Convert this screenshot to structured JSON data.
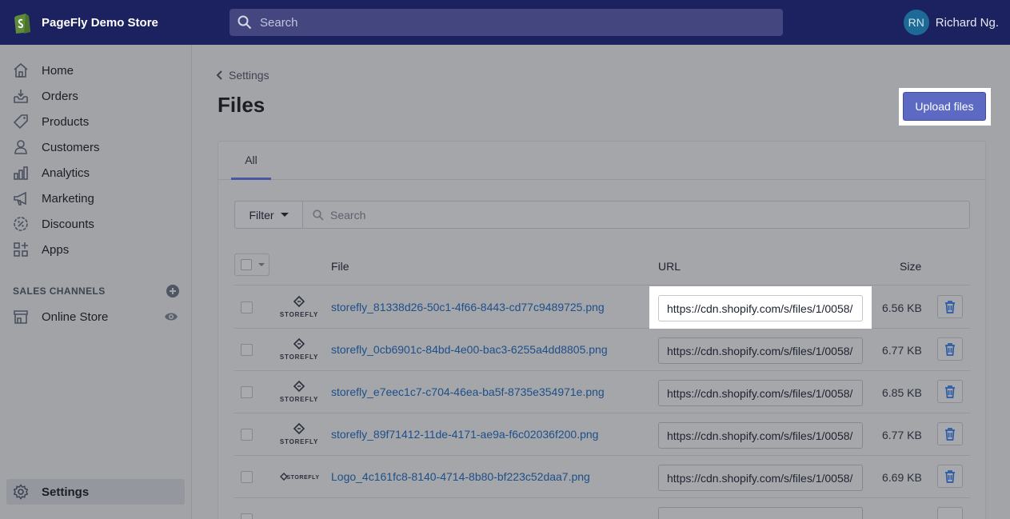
{
  "topbar": {
    "store_name": "PageFly Demo Store",
    "search_placeholder": "Search",
    "user_initials": "RN",
    "user_name": "Richard Ng."
  },
  "sidebar": {
    "items": [
      {
        "label": "Home",
        "icon": "home-icon"
      },
      {
        "label": "Orders",
        "icon": "orders-icon"
      },
      {
        "label": "Products",
        "icon": "tag-icon"
      },
      {
        "label": "Customers",
        "icon": "person-icon"
      },
      {
        "label": "Analytics",
        "icon": "bar-chart-icon"
      },
      {
        "label": "Marketing",
        "icon": "megaphone-icon"
      },
      {
        "label": "Discounts",
        "icon": "discount-icon"
      },
      {
        "label": "Apps",
        "icon": "apps-icon"
      }
    ],
    "sales_channels_title": "SALES CHANNELS",
    "online_store_label": "Online Store",
    "settings_label": "Settings"
  },
  "main": {
    "breadcrumb": "Settings",
    "title": "Files",
    "upload_label": "Upload files",
    "tab_all": "All",
    "filter_label": "Filter",
    "search_placeholder": "Search",
    "col_file": "File",
    "col_url": "URL",
    "col_size": "Size",
    "files": [
      {
        "name": "storefly_81338d26-50c1-4f66-8443-cd77c9489725.png",
        "url": "https://cdn.shopify.com/s/files/1/0058/",
        "size": "6.56 KB",
        "thumb": "storefly-logo-stacked"
      },
      {
        "name": "storefly_0cb6901c-84bd-4e00-bac3-6255a4dd8805.png",
        "url": "https://cdn.shopify.com/s/files/1/0058/",
        "size": "6.77 KB",
        "thumb": "storefly-logo-stacked"
      },
      {
        "name": "storefly_e7eec1c7-c704-46ea-ba5f-8735e354971e.png",
        "url": "https://cdn.shopify.com/s/files/1/0058/",
        "size": "6.85 KB",
        "thumb": "storefly-logo-stacked"
      },
      {
        "name": "storefly_89f71412-11de-4171-ae9a-f6c02036f200.png",
        "url": "https://cdn.shopify.com/s/files/1/0058/",
        "size": "6.77 KB",
        "thumb": "storefly-logo-stacked"
      },
      {
        "name": "Logo_4c161fc8-8140-4714-8b80-bf223c52daa7.png",
        "url": "https://cdn.shopify.com/s/files/1/0058/",
        "size": "6.69 KB",
        "thumb": "storefly-logo-inline"
      }
    ]
  },
  "colors": {
    "topbar": "#1c2260",
    "accent": "#5c6ac4",
    "link": "#1d4f8a"
  }
}
